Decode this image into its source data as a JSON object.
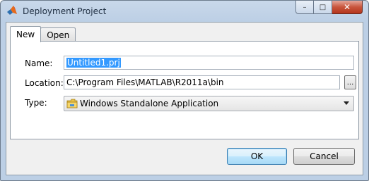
{
  "window": {
    "title": "Deployment Project",
    "buttons": {
      "minimize": "–",
      "maximize": "□",
      "close": "✕"
    }
  },
  "tabs": [
    {
      "label": "New",
      "active": true
    },
    {
      "label": "Open",
      "active": false
    }
  ],
  "form": {
    "name_label": "Name:",
    "name_value": "Untitled1.prj",
    "location_label": "Location:",
    "location_value": "C:\\Program Files\\MATLAB\\R2011a\\bin",
    "browse_label": "...",
    "type_label": "Type:",
    "type_value": "Windows Standalone Application"
  },
  "footer": {
    "ok_label": "OK",
    "cancel_label": "Cancel"
  },
  "colors": {
    "accent": "#3399ff",
    "titlebar": "#bccfe5",
    "close": "#c8563c"
  },
  "icons": {
    "app": "matlab-logo-icon",
    "type": "folder-icon"
  }
}
